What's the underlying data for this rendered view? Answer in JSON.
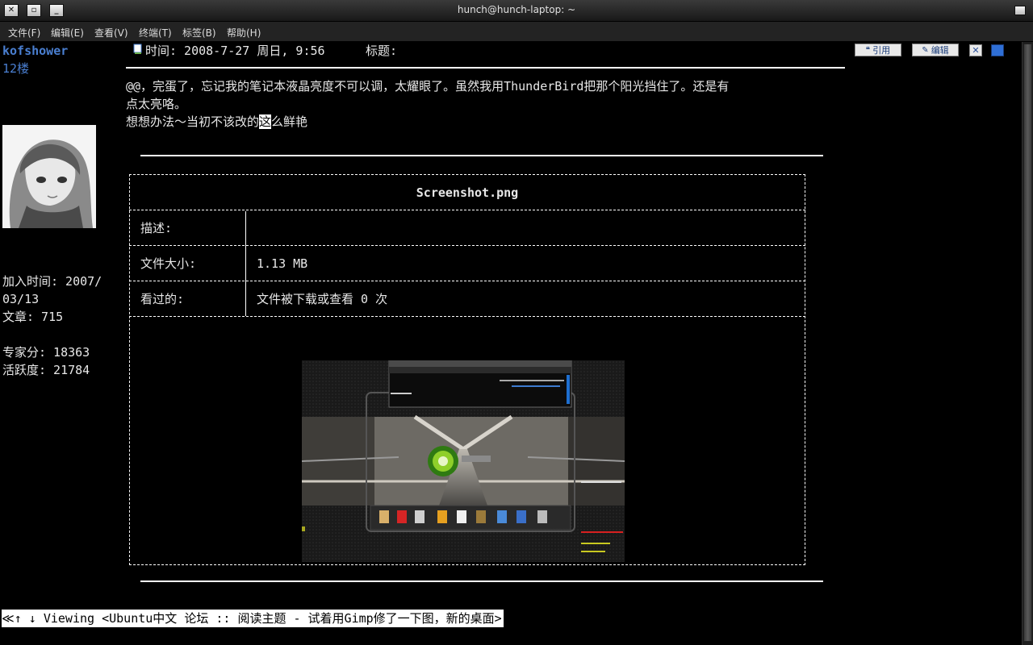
{
  "window": {
    "title": "hunch@hunch-laptop: ~",
    "close_glyph": "✕",
    "maximize_glyph": "▫",
    "minimize_glyph": "_"
  },
  "menu": {
    "file": "文件(F)",
    "edit": "编辑(E)",
    "view": "查看(V)",
    "terminal": "终端(T)",
    "tabs": "标签(B)",
    "help": "帮助(H)"
  },
  "post": {
    "author": "kofshower",
    "floor": "12楼",
    "time_line": "时间: 2008-7-27 周日, 9:56",
    "title_label": "标题:",
    "body_line1": "@@，完蛋了，忘记我的笔记本液晶亮度不可以调，太耀眼了。虽然我用ThunderBird把那个阳光挡住了。还是有",
    "body_line2": "点太亮咯。",
    "body_line3_pre": "想想办法～当初不该改的",
    "body_line3_cursor": "这",
    "body_line3_post": "么鲜艳"
  },
  "user_info": {
    "join_line1": "加入时间: 2007/",
    "join_line2": "03/13",
    "posts": "文章: 715",
    "expert": "专家分: 18363",
    "activity": "活跃度: 21784"
  },
  "buttons": {
    "quote": "引用",
    "edit": "编辑",
    "delete_glyph": "✕"
  },
  "attachment": {
    "filename": "Screenshot.png",
    "desc_label": "描述:",
    "desc_value": "",
    "size_label": "文件大小:",
    "size_value": "1.13 MB",
    "views_label": "看过的:",
    "views_value": "文件被下载或查看 0 次"
  },
  "status_bar": "≪↑ ↓ Viewing <Ubuntu中文 论坛 :: 阅读主题 - 试着用Gimp修了一下图，新的桌面>",
  "colors": {
    "link_blue": "#4a7fd1",
    "background": "#000000",
    "text": "#e8e8e8"
  },
  "icons": [
    "close-icon",
    "maximize-icon",
    "minimize-icon",
    "restore-icon",
    "post-icon",
    "quote-icon",
    "edit-icon",
    "delete-icon",
    "ip-icon",
    "avatar"
  ]
}
